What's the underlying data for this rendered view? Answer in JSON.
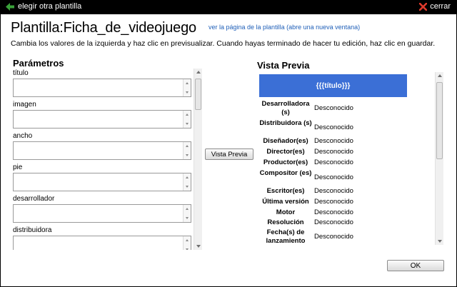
{
  "header": {
    "back_label": "elegir otra plantilla",
    "close_label": "cerrar",
    "back_icon": "arrow-left-icon",
    "close_icon": "close-x-icon",
    "accent_green": "#3aa23a",
    "close_red": "#e03a2c"
  },
  "page": {
    "title": "Plantilla:Ficha_de_videojuego",
    "template_link": "ver la página de la plantilla (abre una nueva ventana)",
    "instructions": "Cambia los valores de la izquierda y haz clic en previsualizar. Cuando hayas terminado de hacer tu edición, haz clic en guardar."
  },
  "params": {
    "heading": "Parámetros",
    "fields": [
      {
        "label": "título",
        "value": ""
      },
      {
        "label": "imagen",
        "value": ""
      },
      {
        "label": "ancho",
        "value": ""
      },
      {
        "label": "pie",
        "value": ""
      },
      {
        "label": "desarrollador",
        "value": ""
      },
      {
        "label": "distribuidora",
        "value": ""
      }
    ]
  },
  "preview_button": "Vista Previa",
  "preview": {
    "heading": "Vista Previa",
    "title_placeholder": "{{{título}}}",
    "title_bg": "#3b6fd6",
    "rows": [
      {
        "key": "Desarrolladora (s)",
        "value": "Desconocido"
      },
      {
        "key": "Distribuidora (s)",
        "value": "Desconocido"
      },
      {
        "key": "Diseñador(es)",
        "value": "Desconocido"
      },
      {
        "key": "Director(es)",
        "value": "Desconocido"
      },
      {
        "key": "Productor(es)",
        "value": "Desconocido"
      },
      {
        "key": "Compositor (es)",
        "value": "Desconocido"
      },
      {
        "key": "Escritor(es)",
        "value": "Desconocido"
      },
      {
        "key": "Última versión",
        "value": "Desconocido"
      },
      {
        "key": "Motor",
        "value": "Desconocido"
      },
      {
        "key": "Resolución",
        "value": "Desconocido"
      },
      {
        "key": "Fecha(s) de lanzamiento",
        "value": "Desconocido"
      }
    ]
  },
  "ok_button": "OK"
}
